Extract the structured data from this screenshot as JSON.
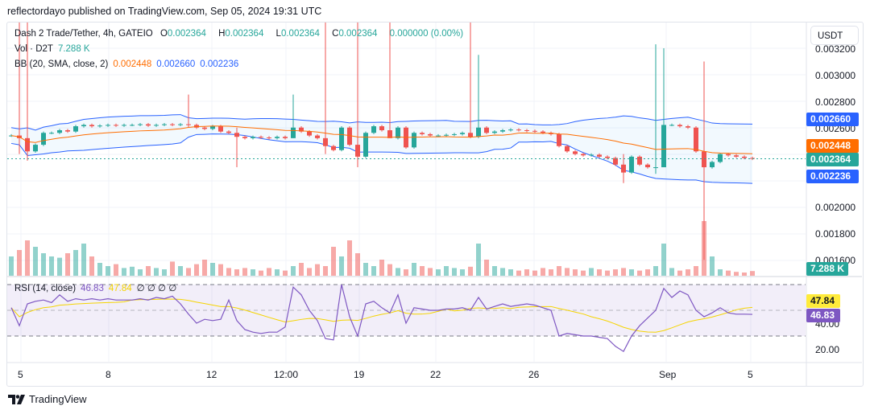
{
  "header": {
    "published": "reflectordayo published on TradingView.com, Sep 05, 2024 19:31 UTC"
  },
  "legend": {
    "symbol": "Dash 2 Trade/Tether, 4h, GATEIO",
    "o_label": "O",
    "o": "0.002364",
    "h_label": "H",
    "h": "0.002364",
    "l_label": "L",
    "l": "0.002364",
    "c_label": "C",
    "c": "0.002364",
    "change": "0.000000 (0.00%)",
    "vol_label": "Vol · D2T",
    "vol": "7.288 K",
    "bb_label": "BB (20, SMA, close, 2)",
    "bb_mid": "0.002448",
    "bb_upper": "0.002660",
    "bb_lower": "0.002236",
    "rsi_label": "RSI (14, close)",
    "rsi": "46.83",
    "rsi_ma": "47.84",
    "rsi_extra": "∅ ∅ ∅ ∅"
  },
  "axis": {
    "currency": "USDT",
    "price_ticks": [
      "0.003200",
      "0.003000",
      "0.002800",
      "0.002600",
      "0.002000",
      "0.001800",
      "0.001600"
    ],
    "rsi_ticks": [
      "40.00",
      "20.00"
    ],
    "x_ticks": [
      "5",
      "8",
      "12",
      "12:00",
      "19",
      "22",
      "26",
      "Sep",
      "5"
    ],
    "tags": {
      "bb_upper": "0.002660",
      "bb_mid": "0.002448",
      "last": "0.002364",
      "bb_lower": "0.002236",
      "vol": "7.288 K",
      "rsi_ma": "47.84",
      "rsi": "46.83"
    }
  },
  "colors": {
    "up": "#26a69a",
    "down": "#ef5350",
    "bb_mid": "#ff6d00",
    "bb_band": "#2962ff",
    "rsi": "#7e57c2",
    "rsi_ma": "#f5d400"
  },
  "footer": {
    "brand": "TradingView"
  },
  "chart_data": {
    "type": "candlestick",
    "unit": "price×1e-6",
    "closes": [
      2540,
      2520,
      2420,
      2470,
      2560,
      2560,
      2580,
      2570,
      2610,
      2620,
      2610,
      2615,
      2620,
      2615,
      2620,
      2620,
      2625,
      2615,
      2620,
      2625,
      2620,
      2625,
      2620,
      2600,
      2590,
      2610,
      2570,
      2560,
      2530,
      2520,
      2530,
      2525,
      2520,
      2530,
      2520,
      2600,
      2570,
      2540,
      2520,
      2460,
      2430,
      2600,
      2470,
      2380,
      2560,
      2610,
      2580,
      2520,
      2600,
      2450,
      2560,
      2550,
      2540,
      2540,
      2545,
      2550,
      2560,
      2530,
      2600,
      2560,
      2570,
      2580,
      2585,
      2580,
      2575,
      2570,
      2560,
      2550,
      2460,
      2420,
      2400,
      2390,
      2395,
      2380,
      2370,
      2320,
      2260,
      2380,
      2320,
      2300,
      2300,
      2620,
      2620,
      2610,
      2600,
      2420,
      2300,
      2340,
      2400,
      2390,
      2380,
      2370,
      2364
    ],
    "spikes": [
      [
        1,
        3400,
        2400
      ],
      [
        2,
        3400,
        2350
      ],
      [
        22,
        2850,
        2600
      ],
      [
        28,
        2600,
        2300
      ],
      [
        35,
        2850,
        2520
      ],
      [
        39,
        3400,
        2400
      ],
      [
        43,
        3400,
        2300
      ],
      [
        47,
        3400,
        2520
      ],
      [
        57,
        3400,
        2520
      ],
      [
        58,
        3150,
        2520
      ],
      [
        76,
        2400,
        2180
      ],
      [
        80,
        3230,
        2250
      ],
      [
        81,
        3200,
        2300
      ],
      [
        86,
        3100,
        1600
      ]
    ],
    "volume_k": [
      30,
      40,
      55,
      45,
      35,
      30,
      28,
      35,
      40,
      50,
      30,
      20,
      15,
      18,
      12,
      14,
      10,
      15,
      12,
      10,
      22,
      15,
      12,
      18,
      25,
      20,
      18,
      12,
      10,
      12,
      10,
      8,
      12,
      10,
      8,
      15,
      20,
      12,
      18,
      15,
      45,
      30,
      55,
      35,
      20,
      15,
      25,
      18,
      12,
      10,
      20,
      15,
      12,
      10,
      15,
      12,
      10,
      14,
      50,
      25,
      15,
      12,
      10,
      8,
      10,
      8,
      12,
      10,
      15,
      12,
      10,
      8,
      12,
      10,
      8,
      10,
      12,
      10,
      8,
      10,
      15,
      50,
      12,
      8,
      10,
      15,
      85,
      30,
      10,
      8,
      6,
      5,
      7.288
    ],
    "rsi": [
      52,
      38,
      55,
      57,
      58,
      56,
      62,
      57,
      59,
      58,
      59,
      58,
      59,
      58,
      58,
      58,
      59,
      58,
      60,
      59,
      61,
      55,
      47,
      40,
      43,
      42,
      43,
      58,
      42,
      35,
      33,
      32,
      33,
      33,
      37,
      68,
      62,
      50,
      42,
      28,
      27,
      70,
      45,
      30,
      55,
      57,
      52,
      48,
      62,
      40,
      52,
      51,
      50,
      50,
      51,
      51,
      52,
      50,
      60,
      51,
      53,
      55,
      53,
      54,
      55,
      54,
      52,
      50,
      30,
      32,
      31,
      30,
      30,
      29,
      28,
      22,
      18,
      30,
      38,
      44,
      50,
      67,
      60,
      65,
      62,
      50,
      45,
      48,
      52,
      48,
      47,
      47,
      46.83
    ],
    "price_range": [
      0.0016,
      0.0032
    ],
    "rsi_range": [
      20,
      70
    ]
  }
}
